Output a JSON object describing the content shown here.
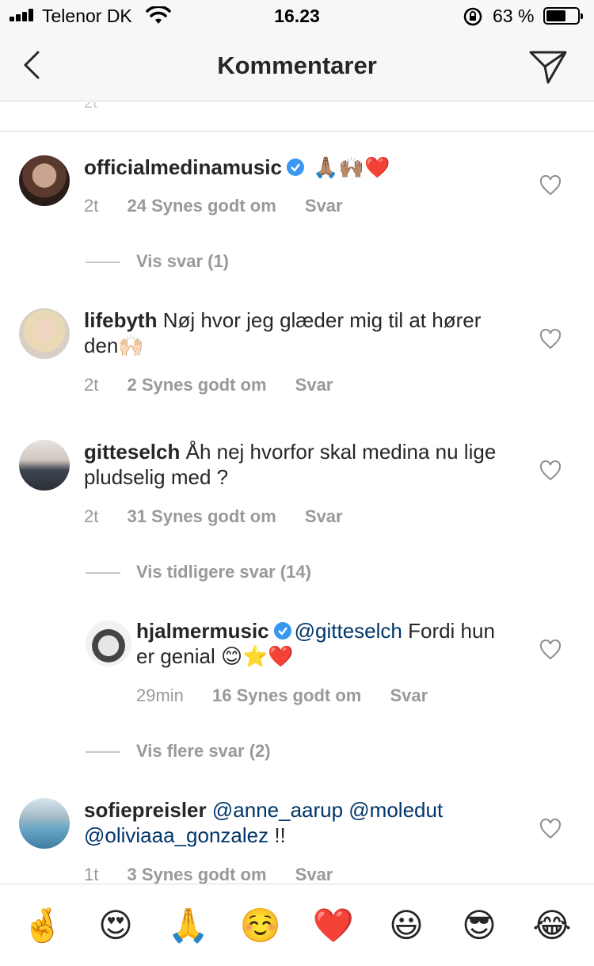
{
  "status_bar": {
    "carrier": "Telenor DK",
    "time": "16.23",
    "battery": "63 %",
    "battery_level": 0.63
  },
  "header": {
    "title": "Kommentarer",
    "back_icon": "chevron-left-icon",
    "send_icon": "paper-plane-icon"
  },
  "colors": {
    "mention": "#003569",
    "verified": "#3897f0",
    "meta": "#999999"
  },
  "comments": [
    {
      "username": "officialmedinamusic",
      "verified": true,
      "text": "🙏🏽🙌🏽❤️",
      "time": "2t",
      "likes": "24 Synes godt om",
      "reply": "Svar"
    },
    {
      "username": "lifebyth",
      "text": "Nøj hvor jeg glæder mig til at hører den🙌🏻",
      "time": "2t",
      "likes": "2 Synes godt om",
      "reply": "Svar"
    },
    {
      "username": "gitteselch",
      "text": "Åh nej hvorfor skal medina nu lige pludselig med ?",
      "time": "2t",
      "likes": "31 Synes godt om",
      "reply": "Svar"
    },
    {
      "username": "hjalmermusic",
      "verified": true,
      "mention": "@gitteselch",
      "text": " Fordi hun er genial 😊⭐️❤️",
      "time": "29min",
      "likes": "16 Synes godt om",
      "reply": "Svar"
    },
    {
      "username": "sofiepreisler",
      "mention": "@anne_aarup @moledut @oliviaaa_gonzalez",
      "text": " !!",
      "time": "1t",
      "likes": "3 Synes godt om",
      "reply": "Svar"
    }
  ],
  "toggles": {
    "vis_svar": "Vis svar (1)",
    "vis_tidligere": "Vis tidligere svar (14)",
    "vis_flere": "Vis flere svar (2)"
  },
  "emoji_bar": [
    "🤞",
    "😍",
    "🙏",
    "☺️",
    "❤️",
    "😃",
    "😎",
    "😂"
  ]
}
